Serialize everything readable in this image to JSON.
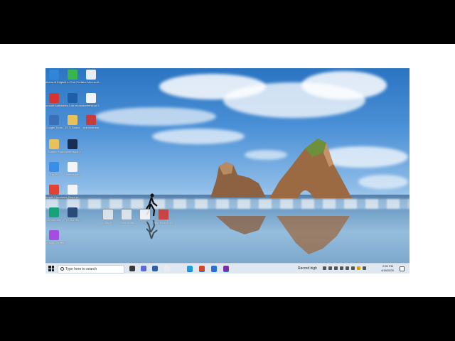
{
  "desktop": {
    "icons": [
      {
        "name": "edge-desktop-icon",
        "label": "Microsoft Edge",
        "color": "#2f86d8"
      },
      {
        "name": "add-app-desktop-icon",
        "label": "Add to Cart Contents",
        "color": "#39b54a"
      },
      {
        "name": "document-desktop-icon",
        "label": "New Microsoft...",
        "color": "#e9edf2"
      },
      {
        "name": "app-red-desktop-icon",
        "label": "Microsoft Authenticator",
        "color": "#d9322f"
      },
      {
        "name": "camera-desktop-icon",
        "label": "Video Lab recorder",
        "color": "#1f5ea8"
      },
      {
        "name": "notepad-desktop-icon",
        "label": "screenshot 3",
        "color": "#f2f4f6"
      },
      {
        "name": "google-tools-desktop-icon",
        "label": "Google Tools",
        "color": "#3b6fb6"
      },
      {
        "name": "folder-desktop-icon",
        "label": "ETG Books",
        "color": "#e8c15a"
      },
      {
        "name": "app-desktop-icon",
        "label": "Adminstrator",
        "color": "#c63c3c"
      },
      {
        "name": "person-folder-desktop-icon",
        "label": "Dr. Sumter Roots",
        "color": "#e8c15a"
      },
      {
        "name": "screenshot-desktop-icon",
        "label": "Screenshot 1",
        "color": "#1a2e55"
      },
      {
        "name": "this-pc-desktop-icon",
        "label": "This PC",
        "color": "#3a8ee6"
      },
      {
        "name": "screenshot2-desktop-icon",
        "label": "Screenshot 2",
        "color": "#f2f4f6"
      },
      {
        "name": "chrome-desktop-icon",
        "label": "Google Chrome",
        "color": "#e34133"
      },
      {
        "name": "file-desktop-icon",
        "label": "ex-Zoom re...",
        "color": "#f2f4f6"
      },
      {
        "name": "grammarly-desktop-icon",
        "label": "Grammarly",
        "color": "#15a37a"
      },
      {
        "name": "screenshot3-desktop-icon",
        "label": "ETG Screen...",
        "color": "#2b4a7a"
      },
      {
        "name": "colorful-app-desktop-icon",
        "label": "Microsoft Content Services",
        "color": "#a64ce0"
      }
    ],
    "dragged_files": [
      {
        "name": "dragged-file-1-icon",
        "label": "A dragR...",
        "color": "#e9edf2"
      },
      {
        "name": "dragged-file-2-icon",
        "label": "Screenshots",
        "color": "#e9edf2"
      },
      {
        "name": "dragged-file-3-icon",
        "label": "Fill",
        "color": "#ffffff"
      },
      {
        "name": "dragged-file-4-icon",
        "label": "Tour Microsoft 2",
        "color": "#d9322f"
      }
    ]
  },
  "taskbar": {
    "search_placeholder": "Type here to search",
    "apps": [
      {
        "name": "copilot-taskbar-icon",
        "color": "#5a6ad8"
      },
      {
        "name": "task-view-taskbar-icon",
        "color": "#3a3a3a"
      },
      {
        "name": "mail-taskbar-icon",
        "color": "#2d5fa8"
      },
      {
        "name": "file-taskbar-icon",
        "color": "#e9edf2"
      },
      {
        "name": "edge-taskbar-icon",
        "color": "#1d9dd7"
      },
      {
        "name": "powerpoint-taskbar-icon",
        "color": "#d24726"
      },
      {
        "name": "app-taskbar-icon",
        "color": "#2a6fd6"
      },
      {
        "name": "onenote-taskbar-icon",
        "color": "#7b2fa6"
      }
    ],
    "record_label": "Record high",
    "clock_time": "2:59 PM",
    "clock_date": "4/18/2025"
  }
}
